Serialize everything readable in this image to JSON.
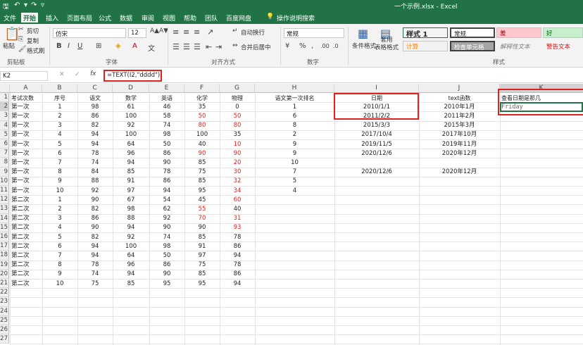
{
  "window": {
    "title": "一个示例.xlsx  -  Excel"
  },
  "tabs": [
    "文件",
    "开始",
    "插入",
    "页面布局",
    "公式",
    "数据",
    "审阅",
    "视图",
    "帮助",
    "团队",
    "百度网盘"
  ],
  "tell_me": "操作说明搜索",
  "ribbon": {
    "clipboard": {
      "paste": "粘贴",
      "cut": "剪切",
      "copy": "复制",
      "format_painter": "格式刷",
      "group": "剪贴板"
    },
    "font": {
      "name": "仿宋",
      "size": "12",
      "group": "字体"
    },
    "alignment": {
      "wrap": "自动换行",
      "merge": "合并后居中",
      "group": "对齐方式"
    },
    "number": {
      "format": "常规",
      "group": "数字"
    },
    "styles": {
      "conditional": "条件格式",
      "table": "套用\n表格格式",
      "group": "样式",
      "gallery": [
        "样式 1",
        "常规",
        "差",
        "好",
        "计算",
        "检查单元格",
        "解释性文本",
        "警告文本"
      ]
    }
  },
  "formula_bar": {
    "name_box": "K2",
    "formula": "=TEXT(I2,\"dddd\")",
    "fx": "fx"
  },
  "columns": [
    "A",
    "B",
    "C",
    "D",
    "E",
    "F",
    "G",
    "H",
    "I",
    "J",
    "K"
  ],
  "rows": [
    "1",
    "2",
    "3",
    "4",
    "5",
    "6",
    "7",
    "8",
    "9",
    "10",
    "11",
    "12",
    "13",
    "14",
    "15",
    "16",
    "17",
    "18",
    "19",
    "20",
    "21",
    "22",
    "23",
    "24",
    "25",
    "26",
    "27"
  ],
  "header_row": [
    "考试次数",
    "序号",
    "语文",
    "数学",
    "英语",
    "化学",
    "物理",
    "语文第一次排名",
    "日期",
    "text函数",
    "查看日期是那几"
  ],
  "data_rows": [
    [
      "第一次",
      "1",
      "98",
      "61",
      "46",
      "35",
      "0",
      "1",
      "2010/1/1",
      "2010年1月",
      "Friday"
    ],
    [
      "第一次",
      "2",
      "86",
      "100",
      "58",
      "50",
      "50",
      "6",
      "2011/2/2",
      "2011年2月",
      ""
    ],
    [
      "第一次",
      "3",
      "82",
      "92",
      "74",
      "80",
      "80",
      "8",
      "2015/3/3",
      "2015年3月",
      ""
    ],
    [
      "第一次",
      "4",
      "94",
      "100",
      "98",
      "100",
      "35",
      "2",
      "2017/10/4",
      "2017年10月",
      ""
    ],
    [
      "第一次",
      "5",
      "94",
      "64",
      "50",
      "40",
      "10",
      "9",
      "2019/11/5",
      "2019年11月",
      ""
    ],
    [
      "第一次",
      "6",
      "78",
      "96",
      "86",
      "90",
      "90",
      "9",
      "2020/12/6",
      "2020年12月",
      ""
    ],
    [
      "第一次",
      "7",
      "74",
      "94",
      "90",
      "85",
      "20",
      "10",
      "",
      "",
      ""
    ],
    [
      "第一次",
      "8",
      "84",
      "85",
      "78",
      "75",
      "30",
      "7",
      "2020/12/6",
      "2020年12月",
      ""
    ],
    [
      "第一次",
      "9",
      "88",
      "91",
      "86",
      "85",
      "32",
      "5",
      "",
      "",
      ""
    ],
    [
      "第一次",
      "10",
      "92",
      "97",
      "94",
      "95",
      "34",
      "4",
      "",
      "",
      ""
    ],
    [
      "第二次",
      "1",
      "90",
      "67",
      "54",
      "45",
      "60",
      "",
      "",
      "",
      ""
    ],
    [
      "第二次",
      "2",
      "82",
      "98",
      "62",
      "55",
      "40",
      "",
      "",
      "",
      ""
    ],
    [
      "第二次",
      "3",
      "86",
      "88",
      "92",
      "70",
      "31",
      "",
      "",
      "",
      ""
    ],
    [
      "第二次",
      "4",
      "90",
      "94",
      "90",
      "90",
      "93",
      "",
      "",
      "",
      ""
    ],
    [
      "第二次",
      "5",
      "82",
      "92",
      "74",
      "85",
      "78",
      "",
      "",
      "",
      ""
    ],
    [
      "第二次",
      "6",
      "94",
      "100",
      "98",
      "91",
      "86",
      "",
      "",
      "",
      ""
    ],
    [
      "第二次",
      "7",
      "94",
      "64",
      "50",
      "97",
      "94",
      "",
      "",
      "",
      ""
    ],
    [
      "第二次",
      "8",
      "78",
      "96",
      "86",
      "75",
      "78",
      "",
      "",
      "",
      ""
    ],
    [
      "第二次",
      "9",
      "74",
      "94",
      "90",
      "85",
      "86",
      "",
      "",
      "",
      ""
    ],
    [
      "第二次",
      "10",
      "75",
      "85",
      "95",
      "95",
      "94",
      "",
      "",
      "",
      ""
    ]
  ],
  "red_cells": [
    "1-5",
    "1-6",
    "2-5",
    "2-6",
    "4-6",
    "5-5",
    "5-6",
    "6-6",
    "7-6",
    "8-6",
    "9-6",
    "10-6",
    "11-5",
    "12-5",
    "12-6",
    "13-6"
  ],
  "colors": {
    "accent": "#217346",
    "highlight": "#e0211f"
  }
}
